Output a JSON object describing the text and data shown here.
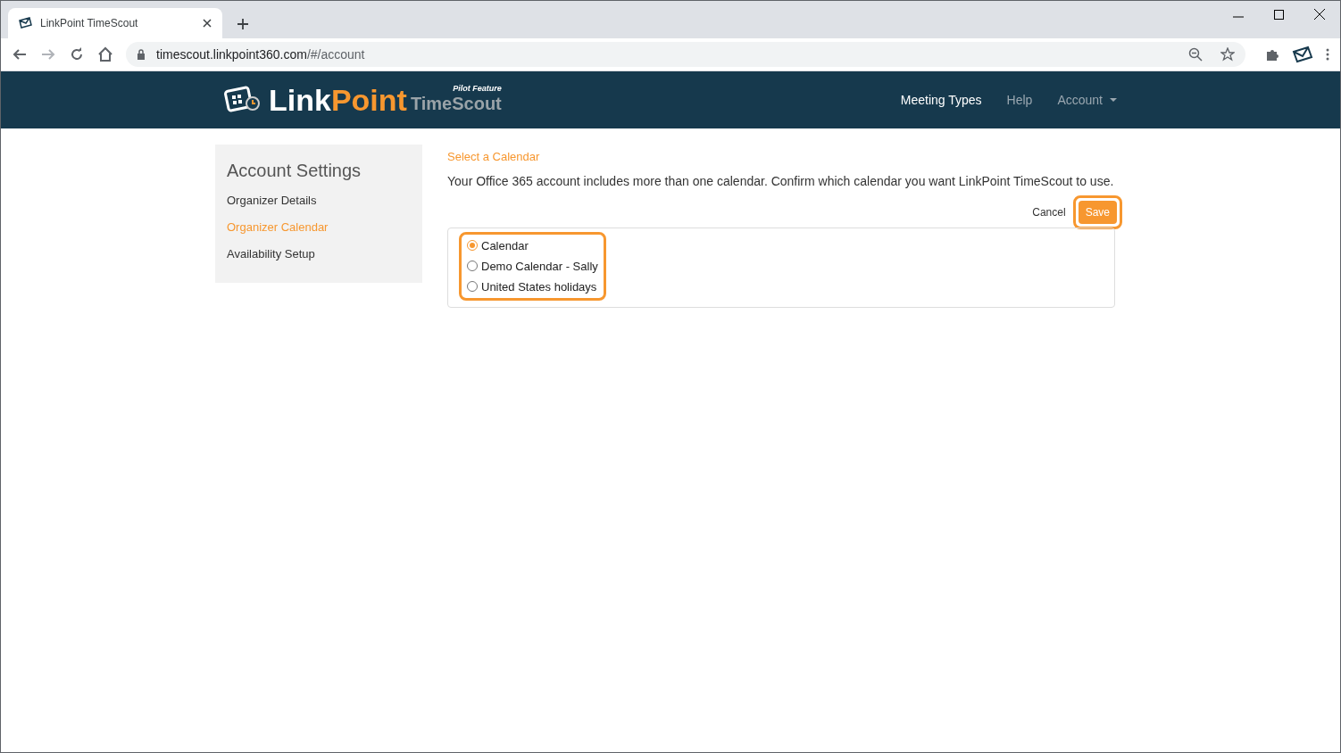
{
  "browser": {
    "tab_title": "LinkPoint TimeScout",
    "url_host": "timescout.linkpoint360.com",
    "url_path": "/#/account"
  },
  "header": {
    "brand_first": "Link",
    "brand_second": "Point",
    "product": "TimeScout",
    "badge": "Pilot Feature",
    "nav": [
      {
        "label": "Meeting Types",
        "selected": true,
        "dropdown": false
      },
      {
        "label": "Help",
        "selected": false,
        "dropdown": false
      },
      {
        "label": "Account",
        "selected": false,
        "dropdown": true
      }
    ]
  },
  "sidebar": {
    "title": "Account Settings",
    "items": [
      {
        "label": "Organizer Details",
        "selected": false
      },
      {
        "label": "Organizer Calendar",
        "selected": true
      },
      {
        "label": "Availability Setup",
        "selected": false
      }
    ]
  },
  "main": {
    "heading": "Select a Calendar",
    "description": "Your Office 365 account includes more than one calendar. Confirm which calendar you want LinkPoint TimeScout to use.",
    "cancel": "Cancel",
    "save": "Save",
    "calendars": [
      {
        "label": "Calendar",
        "selected": true
      },
      {
        "label": "Demo Calendar - Sally",
        "selected": false
      },
      {
        "label": "United States holidays",
        "selected": false
      }
    ]
  }
}
